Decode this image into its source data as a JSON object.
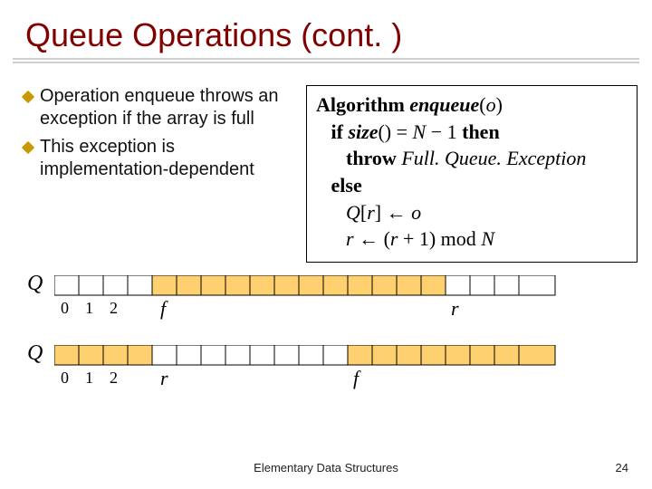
{
  "title": "Queue Operations (cont. )",
  "bullets": [
    "Operation enqueue throws an exception if the array is full",
    "This exception is implementation-dependent"
  ],
  "algorithm": {
    "l0_kw": "Algorithm ",
    "l0_name": "enqueue",
    "l0_paren_open": "(",
    "l0_arg": "o",
    "l0_paren_close": ")",
    "l1_if": "   if ",
    "l1_size": "size",
    "l1_rest1": "() = ",
    "l1_N": "N",
    "l1_rest2": " − 1 ",
    "l1_then": "then",
    "l2a": "      throw ",
    "l2b": "Full. Queue. Exception",
    "l3": "   else",
    "l4a": "      ",
    "l4Q": "Q",
    "l4b": "[",
    "l4r": "r",
    "l4c": "] ← ",
    "l4o": "o",
    "l5a": "      ",
    "l5r1": "r",
    "l5b": " ← (",
    "l5r2": "r",
    "l5c": " + 1) mod ",
    "l5N": "N"
  },
  "array_labels": {
    "Q": "Q",
    "ticks": [
      "0",
      "1",
      "2"
    ],
    "f": "f",
    "r": "r"
  },
  "footer": "Elementary Data Structures",
  "page": "24"
}
